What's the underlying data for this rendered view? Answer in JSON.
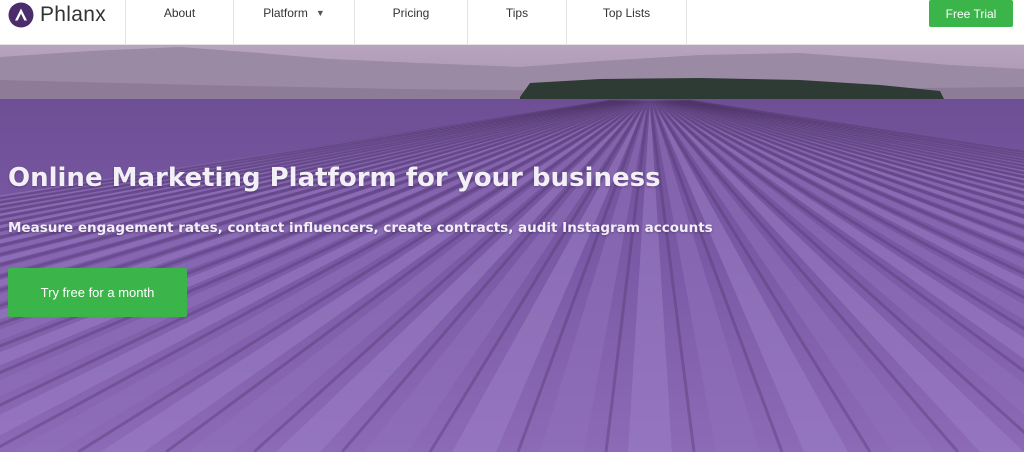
{
  "brand": {
    "name": "Phlanx",
    "logo_icon": "phlanx-logo-icon",
    "accent": "#3bb54a",
    "logo_color": "#4b2d6b"
  },
  "nav": {
    "items": [
      {
        "label": "About"
      },
      {
        "label": "Platform",
        "icon": "caret-down-icon"
      },
      {
        "label": "Pricing"
      },
      {
        "label": "Tips"
      },
      {
        "label": "Top Lists"
      }
    ],
    "cta_label": "Free Trial"
  },
  "hero": {
    "headline": "Online Marketing Platform for your business",
    "subheadline": "Measure engagement rates, contact influencers, create contracts, audit Instagram accounts",
    "cta_label": "Try free for a month",
    "background": "lavender-field-photo"
  }
}
